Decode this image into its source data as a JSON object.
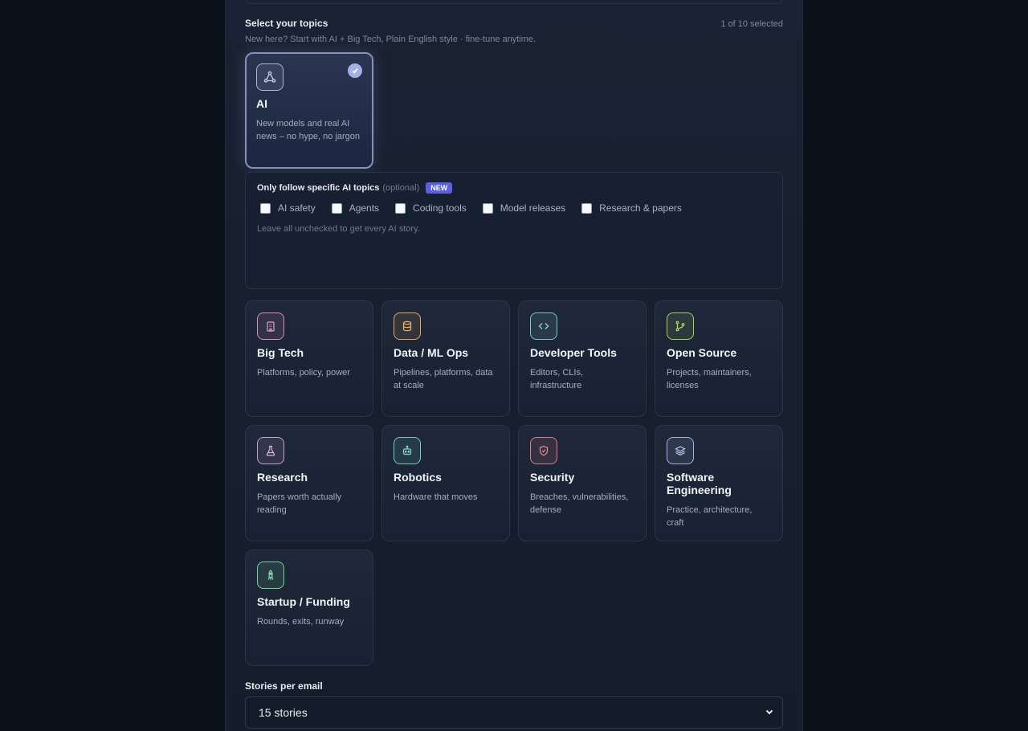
{
  "topics_section": {
    "title": "Select your topics",
    "count": "1 of 10 selected",
    "subtitle": "New here? Start with AI + Big Tech, Plain English style · fine-tune anytime."
  },
  "cards": [
    {
      "key": "ai",
      "title": "AI",
      "desc": "New models and real AI news – no hype, no jargon",
      "icon": "network-icon",
      "color": "#aeb6d6",
      "selected": true
    },
    {
      "key": "big-tech",
      "title": "Big Tech",
      "desc": "Platforms, policy, power",
      "icon": "building-icon",
      "color": "#d68fc0"
    },
    {
      "key": "data-ml-ops",
      "title": "Data / ML Ops",
      "desc": "Pipelines, platforms, data at scale",
      "icon": "database-icon",
      "color": "#e1a85b"
    },
    {
      "key": "developer-tools",
      "title": "Developer Tools",
      "desc": "Editors, CLIs, infrastructure",
      "icon": "code-icon",
      "color": "#7fc7c9"
    },
    {
      "key": "open-source",
      "title": "Open Source",
      "desc": "Projects, maintainers, licenses",
      "icon": "git-branch-icon",
      "color": "#a6cf5e"
    },
    {
      "key": "research",
      "title": "Research",
      "desc": "Papers worth actually reading",
      "icon": "flask-icon",
      "color": "#c8a2d8"
    },
    {
      "key": "robotics",
      "title": "Robotics",
      "desc": "Hardware that moves",
      "icon": "robot-icon",
      "color": "#6fcfbf"
    },
    {
      "key": "security",
      "title": "Security",
      "desc": "Breaches, vulnerabilities, defense",
      "icon": "shield-icon",
      "color": "#e27a8c"
    },
    {
      "key": "software-engineering",
      "title": "Software Engineering",
      "desc": "Practice, architecture, craft",
      "icon": "layers-icon",
      "color": "#a7b3e3"
    },
    {
      "key": "startup-funding",
      "title": "Startup / Funding",
      "desc": "Rounds, exits, runway",
      "icon": "rocket-icon",
      "color": "#73d39a"
    }
  ],
  "ai_subtopics": {
    "title": "Only follow specific AI topics",
    "optional": "(optional)",
    "badge": "NEW",
    "options": [
      "AI safety",
      "Agents",
      "Coding tools",
      "Model releases",
      "Research & papers"
    ],
    "hint": "Leave all unchecked to get every AI story."
  },
  "stories": {
    "label": "Stories per email",
    "value": "15 stories"
  }
}
